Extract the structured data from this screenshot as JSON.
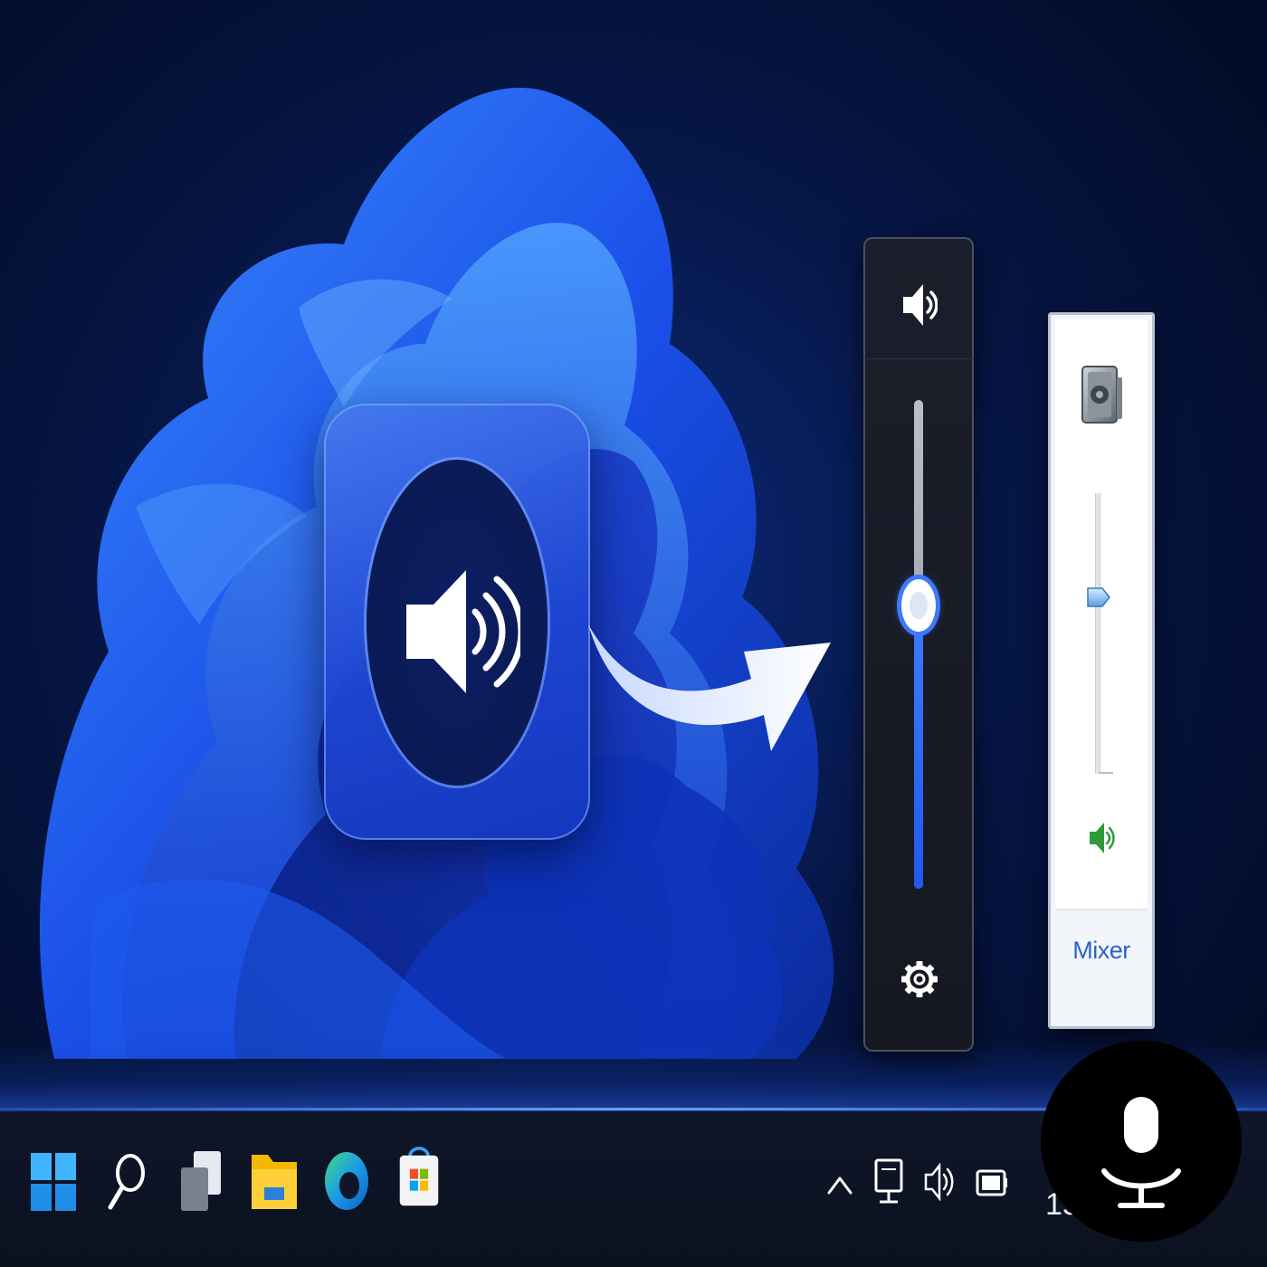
{
  "wallpaper": {
    "style": "windows-11-bloom",
    "accent": "#1f5cff"
  },
  "hero": {
    "icon": "speaker-volume-icon",
    "arrow_icon": "curved-arrow-icon"
  },
  "volume_flyout_modern": {
    "icon": "speaker-icon",
    "level_fraction": 0.58,
    "accent": "#3d78ff",
    "settings_icon": "gear-icon"
  },
  "volume_flyout_legacy": {
    "device_icon": "speakers-device-icon",
    "level_fraction": 0.63,
    "speaker_icon": "speaker-green-icon",
    "mixer_label": "Mixer",
    "link_color": "#2a63c8"
  },
  "taskbar": {
    "pinned": [
      {
        "name": "start-button",
        "icon": "windows-logo-icon"
      },
      {
        "name": "search-button",
        "icon": "search-icon"
      },
      {
        "name": "task-view-button",
        "icon": "task-view-icon"
      },
      {
        "name": "file-explorer-button",
        "icon": "folder-icon"
      },
      {
        "name": "edge-button",
        "icon": "edge-icon"
      },
      {
        "name": "store-button",
        "icon": "store-icon"
      }
    ],
    "tray": [
      {
        "name": "tray-overflow",
        "icon": "chevron-up-icon"
      },
      {
        "name": "tray-network",
        "icon": "network-icon"
      },
      {
        "name": "tray-volume",
        "icon": "volume-icon"
      },
      {
        "name": "tray-battery",
        "icon": "battery-icon"
      }
    ],
    "clock_text": "15/"
  },
  "overlay": {
    "icon": "microphone-icon"
  }
}
